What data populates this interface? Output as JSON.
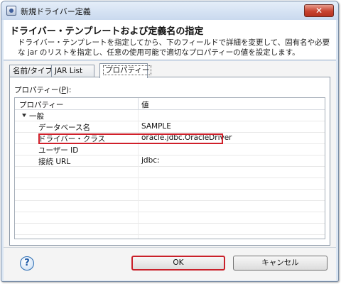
{
  "window": {
    "title": "新規ドライバー定義",
    "close_symbol": "✕"
  },
  "header": {
    "title": "ドライバー・テンプレートおよび定義名の指定",
    "description": "ドライバー・テンプレートを指定してから、下のフィールドで詳細を変更して、固有名や必要な jar のリストを指定し、任意の使用可能で適切なプロパティーの値を設定します。"
  },
  "tabs": [
    {
      "label": "名前/タイプ",
      "active": false
    },
    {
      "label": "JAR List",
      "active": false
    },
    {
      "label": "プロパティー",
      "active": true
    }
  ],
  "properties_section": {
    "label_prefix": "プロパティー(",
    "label_mnemonic": "P",
    "label_suffix": "):"
  },
  "table": {
    "columns": [
      "プロパティー",
      "値"
    ],
    "group": "一般",
    "rows": [
      {
        "name": "データベース名",
        "value": "SAMPLE"
      },
      {
        "name": "ドライバー・クラス",
        "value": "oracle.jdbc.OracleDriver"
      },
      {
        "name": "ユーザー ID",
        "value": ""
      },
      {
        "name": "接続 URL",
        "value": "jdbc:"
      }
    ]
  },
  "footer": {
    "help_symbol": "?",
    "ok_label": "OK",
    "cancel_label": "キャンセル"
  },
  "colors": {
    "annotation_highlight": "#d0202a",
    "title_bar": "#c9d9ee"
  }
}
